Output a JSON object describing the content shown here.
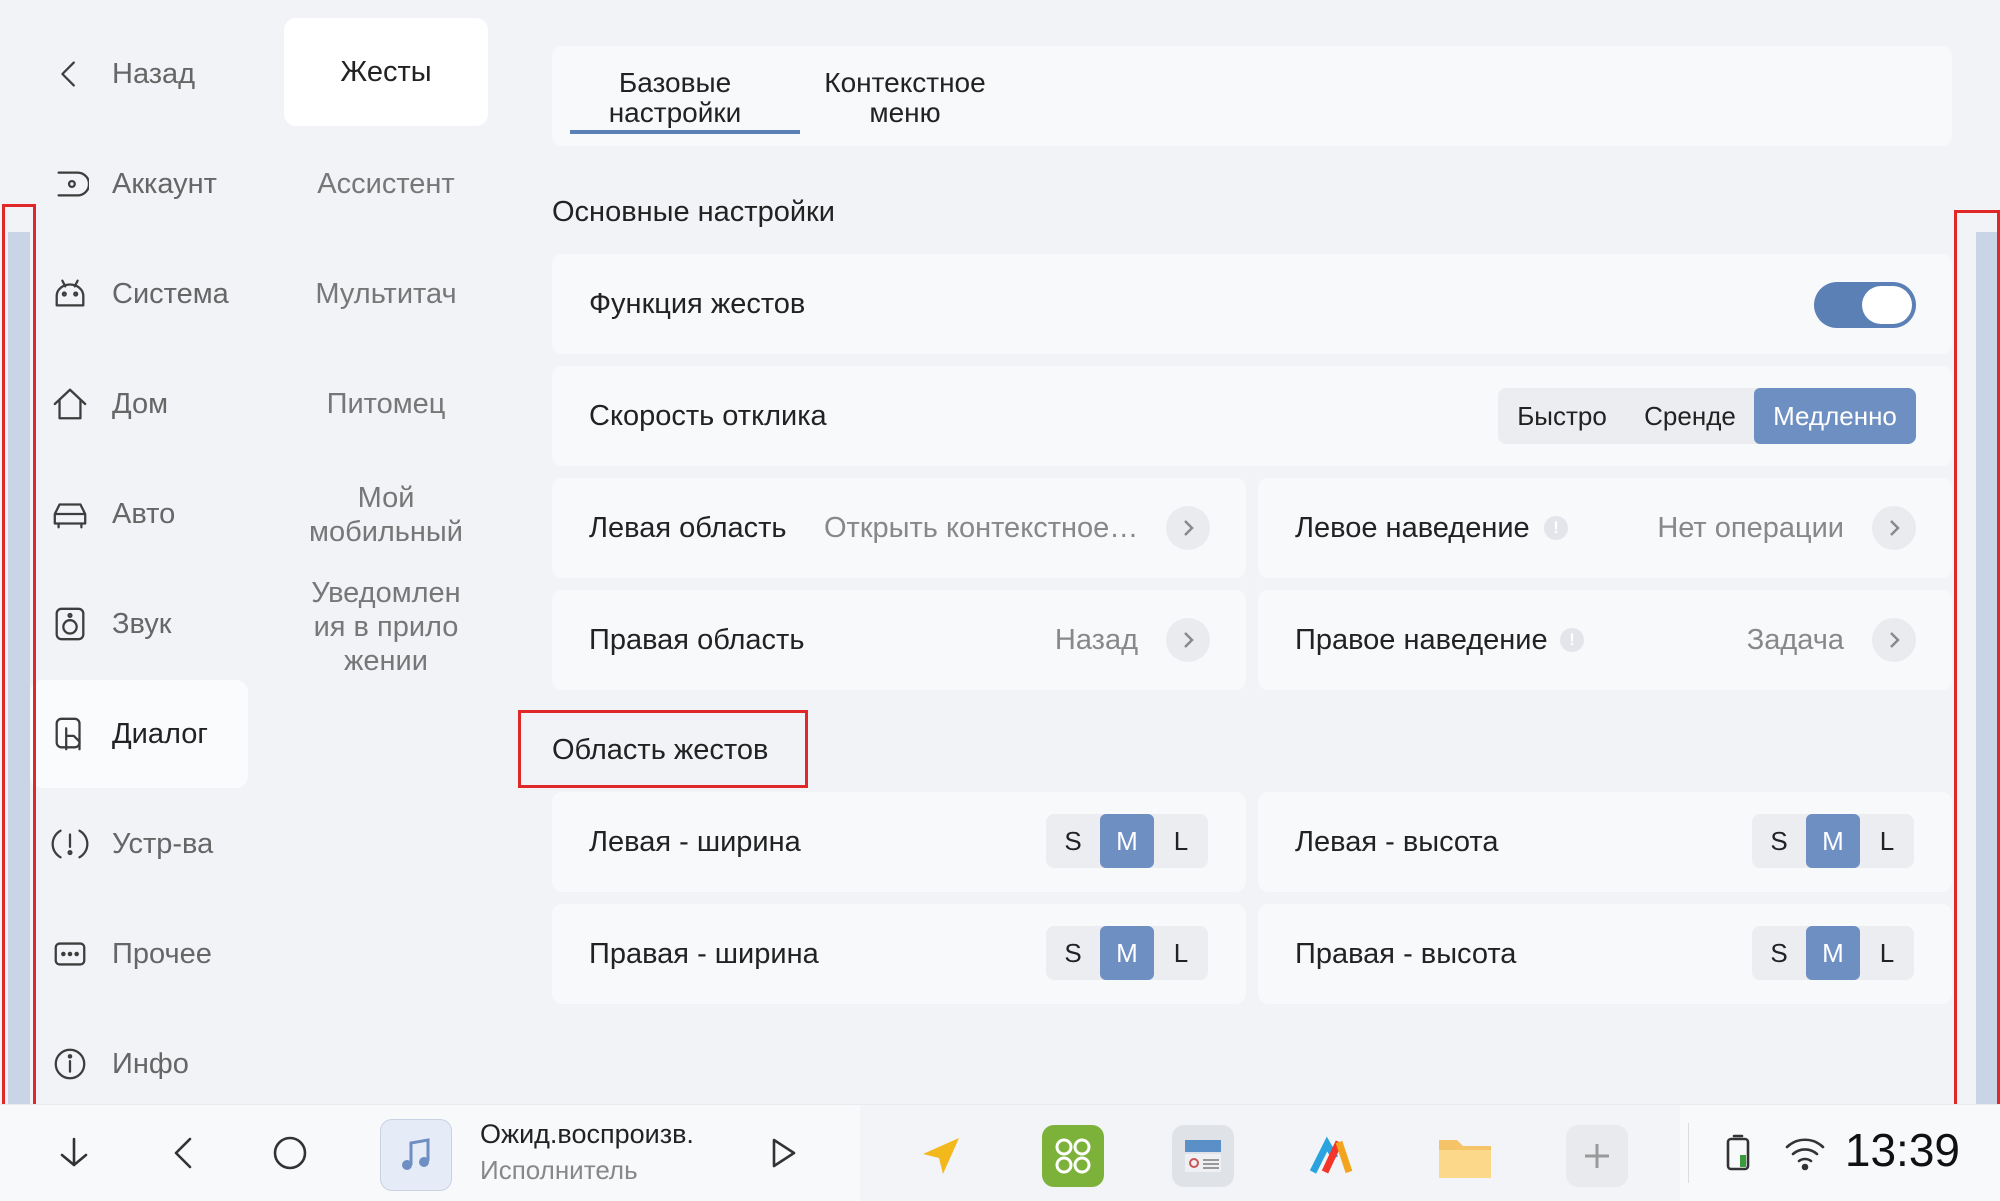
{
  "nav": {
    "items": [
      {
        "label": "Назад",
        "icon": "back-chevron-icon"
      },
      {
        "label": "Аккаунт",
        "icon": "account-icon"
      },
      {
        "label": "Система",
        "icon": "android-icon"
      },
      {
        "label": "Дом",
        "icon": "home-icon"
      },
      {
        "label": "Авто",
        "icon": "car-icon"
      },
      {
        "label": "Звук",
        "icon": "speaker-icon"
      },
      {
        "label": "Диалог",
        "icon": "touch-hand-icon"
      },
      {
        "label": "Устр-ва",
        "icon": "alert-icon"
      },
      {
        "label": "Прочее",
        "icon": "more-icon"
      },
      {
        "label": "Инфо",
        "icon": "info-icon"
      }
    ],
    "active": "Диалог"
  },
  "subnav": {
    "items": [
      "Жесты",
      "Ассистент",
      "Мультитач",
      "Питомец",
      "Мой мобильный",
      "Уведомлен ия в прило жении"
    ],
    "active": "Жесты"
  },
  "tabs": {
    "items": [
      "Базовые настройки",
      "Контекстное меню"
    ],
    "active": "Базовые настройки"
  },
  "basic": {
    "title": "Основные настройки",
    "gesture_function": {
      "label": "Функция жестов",
      "enabled": true
    },
    "response_speed": {
      "label": "Скорость отклика",
      "options": [
        "Быстро",
        "Сренде",
        "Медленно"
      ],
      "selected": "Медленно"
    },
    "left_area": {
      "label": "Левая область",
      "value": "Открыть контекстное…"
    },
    "left_hover": {
      "label": "Левое наведение",
      "value": "Нет операции"
    },
    "right_area": {
      "label": "Правая область",
      "value": "Назад"
    },
    "right_hover": {
      "label": "Правое наведение",
      "value": "Задача"
    }
  },
  "gesture_area": {
    "title": "Область жестов",
    "size_options": [
      "S",
      "M",
      "L"
    ],
    "left_width": {
      "label": "Левая - ширина",
      "selected": "M"
    },
    "left_height": {
      "label": "Левая - высота",
      "selected": "M"
    },
    "right_width": {
      "label": "Правая - ширина",
      "selected": "M"
    },
    "right_height": {
      "label": "Правая - высота",
      "selected": "M"
    }
  },
  "taskbar": {
    "media_title": "Ожид.воспроизв.",
    "media_artist": "Исполнитель",
    "clock": "13:39",
    "apps": [
      "navigator-app-icon",
      "dots-app-icon",
      "radio-app-icon",
      "yandex-app-icon",
      "folder-app-icon",
      "add-app-icon"
    ]
  },
  "colors": {
    "accent": "#6e8fc1",
    "annotation": "#e02828"
  }
}
